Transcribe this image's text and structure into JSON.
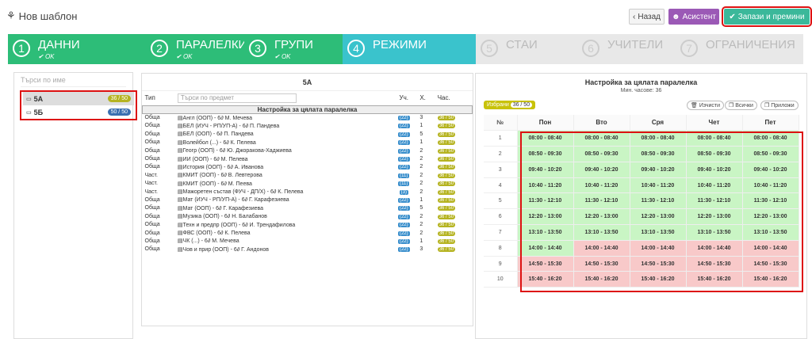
{
  "title": "Нов шаблон",
  "buttons": {
    "back": "Назад",
    "assistant": "Асистент",
    "save": "Запази и премини"
  },
  "steps": [
    {
      "num": "1",
      "label": "ДАННИ",
      "status": "OK"
    },
    {
      "num": "2",
      "label": "ПАРАЛЕЛКИ",
      "status": "OK"
    },
    {
      "num": "3",
      "label": "ГРУПИ",
      "status": "OK"
    },
    {
      "num": "4",
      "label": "РЕЖИМИ",
      "status": ""
    },
    {
      "num": "5",
      "label": "СТАИ",
      "status": ""
    },
    {
      "num": "6",
      "label": "УЧИТЕЛИ",
      "status": ""
    },
    {
      "num": "7",
      "label": "ОГРАНИЧЕНИЯ",
      "status": ""
    }
  ],
  "left": {
    "placeholder": "Търси по име",
    "classes": [
      {
        "name": "5А",
        "count": "36 / 50"
      },
      {
        "name": "5Б",
        "count": "50 / 50"
      }
    ]
  },
  "mid": {
    "title": "5А",
    "cols": {
      "type": "Тип",
      "search": "Търси по предмет",
      "uch": "Уч.",
      "h": "Х.",
      "hours": "Час."
    },
    "section": "Настройка за цялата паралелка",
    "rows": [
      [
        "Обща",
        "Англ (ООП) - 6∂ М. Мечева",
        "(22)",
        "3",
        "36 / 50"
      ],
      [
        "Обща",
        "БЕЛ (ИУЧ - РП/УП-А) - 6∂ П. Пандева",
        "(22)",
        "1",
        "36 / 50"
      ],
      [
        "Обща",
        "БЕЛ (ООП) - 6∂ П. Пандева",
        "(22)",
        "5",
        "36 / 50"
      ],
      [
        "Обща",
        "Волейбол (...) - 6∂ К. Пелева",
        "(22)",
        "1",
        "36 / 50"
      ],
      [
        "Обща",
        "Геогр (ООП) - 6∂ Ю. Джоракова-Хаджиева",
        "(22)",
        "2",
        "36 / 50"
      ],
      [
        "Обща",
        "ИИ (ООП) - 6∂ М. Пелева",
        "(22)",
        "2",
        "36 / 50"
      ],
      [
        "Обща",
        "История (ООП) - 6∂ А. Иванова",
        "(22)",
        "2",
        "36 / 50"
      ],
      [
        "Част.",
        "КМИТ (ООП) - 6∂ В. Левтерова",
        "(11)",
        "2",
        "36 / 50"
      ],
      [
        "Част.",
        "КМИТ (ООП) - 6∂ М. Пеева",
        "(11)",
        "2",
        "36 / 50"
      ],
      [
        "Част.",
        "Мажоретен състав (ФУЧ - ДП/Х) - 6∂ К. Пелева",
        "(3)",
        "2",
        "36 / 50"
      ],
      [
        "Обща",
        "Мат (ИУЧ - РП/УП-А) - 6∂ Г. Карафезиева",
        "(22)",
        "1",
        "36 / 50"
      ],
      [
        "Обща",
        "Мат (ООП) - 6∂ Г. Карафезиева",
        "(22)",
        "5",
        "36 / 50"
      ],
      [
        "Обща",
        "Музика (ООП) - 6∂ Н. Балабанов",
        "(22)",
        "2",
        "36 / 50"
      ],
      [
        "Обща",
        "Техн и предпр (ООП) - 6∂ И. Трендафилова",
        "(22)",
        "2",
        "36 / 50"
      ],
      [
        "Обща",
        "ФВС (ООП) - 6∂ К. Пелева",
        "(22)",
        "2",
        "36 / 50"
      ],
      [
        "Обща",
        "ЧК (...) - 6∂ М. Мечева",
        "(22)",
        "1",
        "36 / 50"
      ],
      [
        "Обща",
        "Чов и прир (ООП) - 6∂ Г. Андонов",
        "(22)",
        "3",
        "36 / 50"
      ]
    ]
  },
  "right": {
    "title": "Настройка за цялата паралелка",
    "minhours": "Мин. часове: 36",
    "fav": "Избрани",
    "favcount": "36 / 50",
    "clear": "Изчисти",
    "all": "Всички",
    "apply": "Приложи",
    "days": [
      "№",
      "Пон",
      "Вто",
      "Сря",
      "Чет",
      "Пет"
    ],
    "slots": [
      "08:00 - 08:40",
      "08:50 - 09:30",
      "09:40 - 10:20",
      "10:40 - 11:20",
      "11:30 - 12:10",
      "12:20 - 13:00",
      "13:10 - 13:50",
      "14:00 - 14:40",
      "14:50 - 15:30",
      "15:40 - 16:20"
    ],
    "green_until": 7,
    "mon_green_until": 8
  }
}
